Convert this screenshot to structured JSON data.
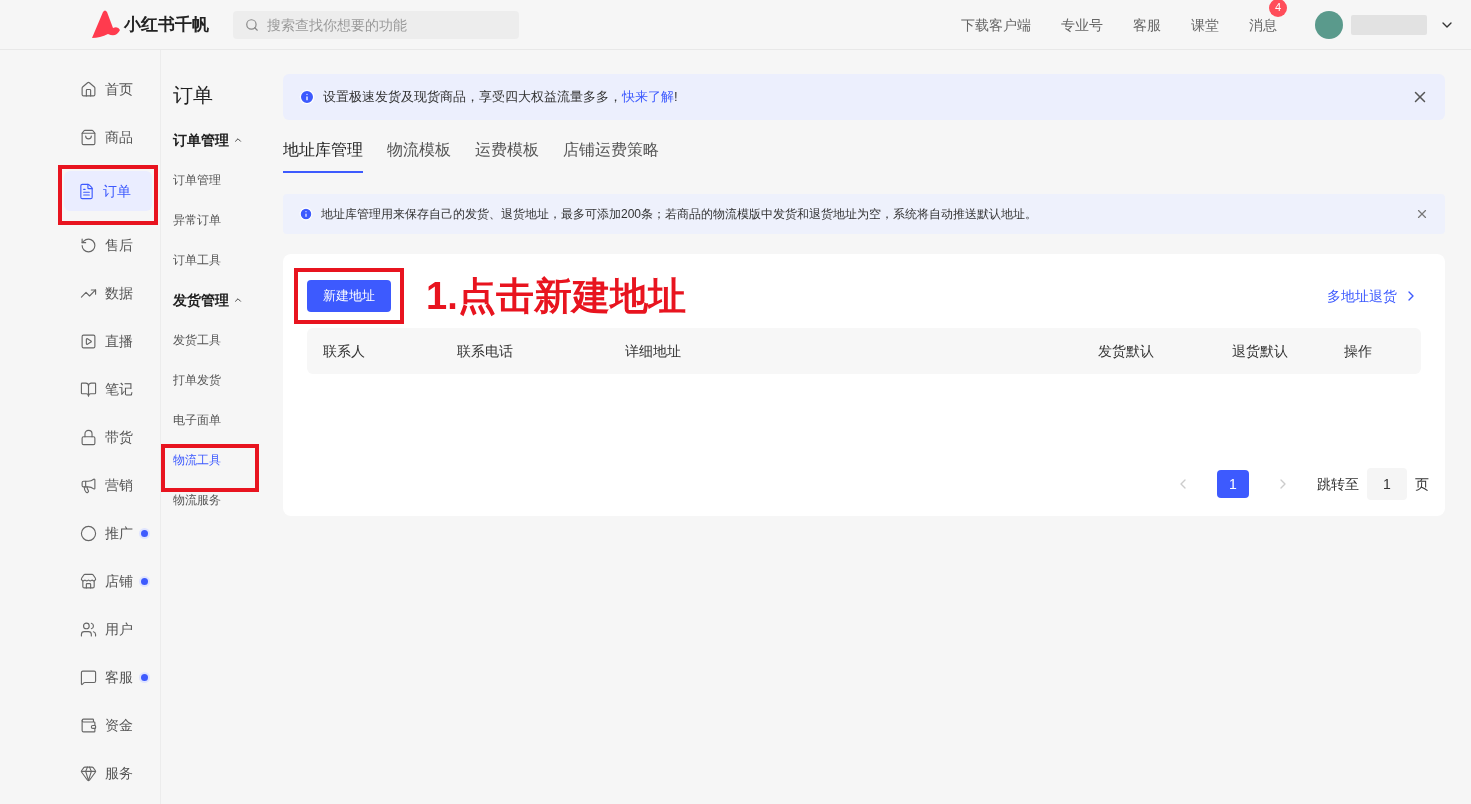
{
  "header": {
    "logo_text": "小红书千帆",
    "search": {
      "placeholder": "搜索查找你想要的功能"
    },
    "links": [
      {
        "label": "下载客户端"
      },
      {
        "label": "专业号"
      },
      {
        "label": "客服"
      },
      {
        "label": "课堂"
      },
      {
        "label": "消息",
        "badge": "4"
      }
    ]
  },
  "sidebar": {
    "items": [
      {
        "label": "首页",
        "selected": false,
        "dot": false,
        "highlighted": false
      },
      {
        "label": "商品",
        "selected": false,
        "dot": false,
        "highlighted": false
      },
      {
        "label": "订单",
        "selected": true,
        "dot": false,
        "highlighted": true
      },
      {
        "label": "售后",
        "selected": false,
        "dot": false,
        "highlighted": false
      },
      {
        "label": "数据",
        "selected": false,
        "dot": false,
        "highlighted": false
      },
      {
        "label": "直播",
        "selected": false,
        "dot": false,
        "highlighted": false
      },
      {
        "label": "笔记",
        "selected": false,
        "dot": false,
        "highlighted": false
      },
      {
        "label": "带货",
        "selected": false,
        "dot": false,
        "highlighted": false
      },
      {
        "label": "营销",
        "selected": false,
        "dot": false,
        "highlighted": false
      },
      {
        "label": "推广",
        "selected": false,
        "dot": true,
        "highlighted": false
      },
      {
        "label": "店铺",
        "selected": false,
        "dot": true,
        "highlighted": false
      },
      {
        "label": "用户",
        "selected": false,
        "dot": false,
        "highlighted": false
      },
      {
        "label": "客服",
        "selected": false,
        "dot": true,
        "highlighted": false
      },
      {
        "label": "资金",
        "selected": false,
        "dot": false,
        "highlighted": false
      },
      {
        "label": "服务",
        "selected": false,
        "dot": false,
        "highlighted": false
      }
    ]
  },
  "subnav": {
    "title": "订单",
    "groups": [
      {
        "label": "订单管理",
        "expanded": true,
        "items": [
          {
            "label": "订单管理",
            "selected": false,
            "highlighted": false
          },
          {
            "label": "异常订单",
            "selected": false,
            "highlighted": false
          },
          {
            "label": "订单工具",
            "selected": false,
            "highlighted": false
          }
        ]
      },
      {
        "label": "发货管理",
        "expanded": true,
        "items": [
          {
            "label": "发货工具",
            "selected": false,
            "highlighted": false
          },
          {
            "label": "打单发货",
            "selected": false,
            "highlighted": false
          },
          {
            "label": "电子面单",
            "selected": false,
            "highlighted": false
          },
          {
            "label": "物流工具",
            "selected": true,
            "highlighted": true
          },
          {
            "label": "物流服务",
            "selected": false,
            "highlighted": false
          }
        ]
      }
    ]
  },
  "banner": {
    "text": "设置极速发货及现货商品，享受四大权益流量多多，",
    "link": "快来了解",
    "suffix": "!"
  },
  "tabs": [
    {
      "label": "地址库管理",
      "selected": true
    },
    {
      "label": "物流模板",
      "selected": false
    },
    {
      "label": "运费模板",
      "selected": false
    },
    {
      "label": "店铺运费策略",
      "selected": false
    }
  ],
  "notice": {
    "text": "地址库管理用来保存自己的发货、退货地址，最多可添加200条；若商品的物流模版中发货和退货地址为空，系统将自动推送默认地址。"
  },
  "panel": {
    "new_button": {
      "label": "新建地址",
      "highlighted": true
    },
    "annotation": "1.点击新建地址",
    "multi_return_link": "多地址退货",
    "table": {
      "columns": [
        "联系人",
        "联系电话",
        "详细地址",
        "发货默认",
        "退货默认",
        "操作"
      ]
    },
    "pagination": {
      "pages": [
        {
          "label": "1",
          "selected": true
        }
      ],
      "jump_label": "跳转至",
      "jump_value": "1",
      "page_suffix": "页"
    }
  }
}
